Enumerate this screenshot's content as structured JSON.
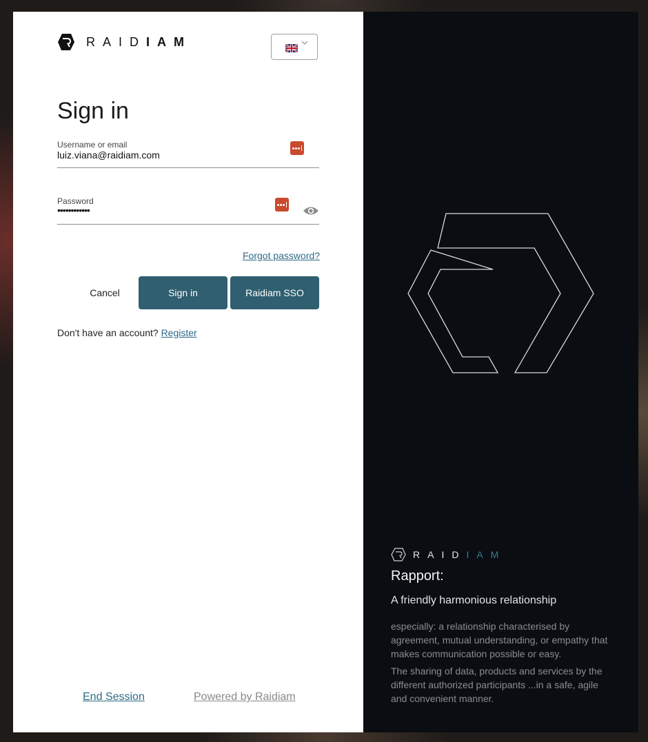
{
  "brand": {
    "wordmark_light": "RAID",
    "wordmark_bold": "IAM"
  },
  "language": {
    "selected": "English (UK)",
    "flag_icon": "uk-flag-icon"
  },
  "form": {
    "title": "Sign in",
    "username": {
      "label": "Username or email",
      "value": "luiz.viana@raidiam.com"
    },
    "password": {
      "label": "Password",
      "masked_value": "••••••••••••"
    },
    "forgot_label": "Forgot password?",
    "cancel_label": "Cancel",
    "signin_label": "Sign in",
    "sso_label": "Raidiam SSO",
    "register_prompt": "Don't have an account?",
    "register_label": "Register"
  },
  "footer": {
    "end_session": "End Session",
    "powered_by": "Powered by Raidiam"
  },
  "side": {
    "wordmark_light": "RAID",
    "wordmark_accent": "IAM",
    "rapport_title": "Rapport:",
    "rapport_subtitle": "A friendly harmonious relationship",
    "rapport_desc1": "especially: a relationship characterised by agreement, mutual understanding, or empathy that makes communication possible or easy.",
    "rapport_desc2": "The sharing of data, products and services by the different authorized participants ...in a safe, agile and convenient manner."
  },
  "colors": {
    "primary_button": "#2f5f70",
    "link": "#2d6a85",
    "password_manager_icon": "#c94a2e",
    "right_panel_bg": "#0a0d12",
    "accent": "#3f7a90"
  }
}
